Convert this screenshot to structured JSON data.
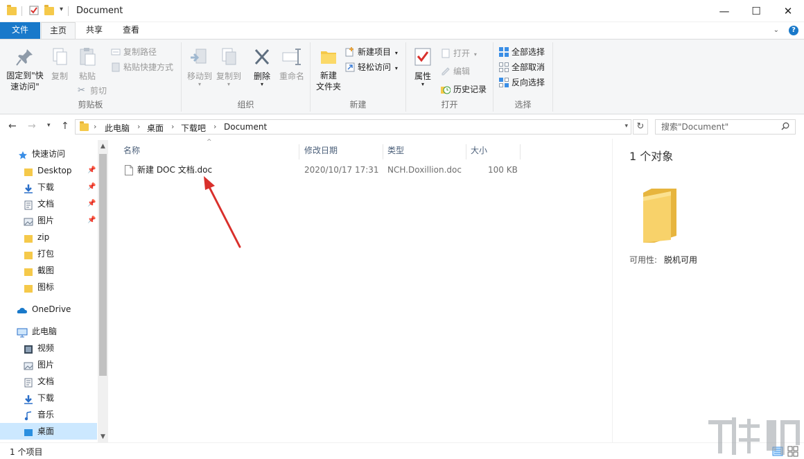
{
  "window": {
    "title": "Document",
    "minimize_glyph": "—",
    "maximize_glyph": "☐",
    "close_glyph": "✕"
  },
  "ribbon_tabs": [
    {
      "label": "文件"
    },
    {
      "label": "主页"
    },
    {
      "label": "共享"
    },
    {
      "label": "查看"
    }
  ],
  "ribbon": {
    "clipboard": {
      "label": "剪贴板",
      "pin_label": "固定到\"快速访问\"",
      "copy_label": "复制",
      "paste_label": "粘贴",
      "copy_path_label": "复制路径",
      "paste_shortcut_label": "粘贴快捷方式",
      "cut_label": "剪切"
    },
    "organize": {
      "label": "组织",
      "move_to_label": "移动到",
      "copy_to_label": "复制到",
      "delete_label": "删除",
      "rename_label": "重命名"
    },
    "new": {
      "label": "新建",
      "new_folder_label": "新建\n文件夹",
      "new_item_label": "新建项目",
      "easy_access_label": "轻松访问"
    },
    "open": {
      "label": "打开",
      "properties_label": "属性",
      "open_label": "打开",
      "edit_label": "编辑",
      "history_label": "历史记录"
    },
    "select": {
      "label": "选择",
      "select_all_label": "全部选择",
      "select_none_label": "全部取消",
      "invert_label": "反向选择"
    }
  },
  "address": {
    "crumbs": [
      "此电脑",
      "桌面",
      "下载吧",
      "Document"
    ],
    "search_placeholder": "搜索\"Document\""
  },
  "nav_pane": {
    "quick_access": "快速访问",
    "items": [
      {
        "label": "Desktop",
        "pinned": true
      },
      {
        "label": "下载",
        "pinned": true
      },
      {
        "label": "文档",
        "pinned": true
      },
      {
        "label": "图片",
        "pinned": true
      },
      {
        "label": "zip",
        "pinned": false
      },
      {
        "label": "打包",
        "pinned": false
      },
      {
        "label": "截图",
        "pinned": false
      },
      {
        "label": "图标",
        "pinned": false
      }
    ],
    "onedrive": "OneDrive",
    "this_pc": "此电脑",
    "pc_items": [
      {
        "label": "视频"
      },
      {
        "label": "图片"
      },
      {
        "label": "文档"
      },
      {
        "label": "下载"
      },
      {
        "label": "音乐"
      },
      {
        "label": "桌面"
      }
    ]
  },
  "file_list": {
    "columns": {
      "name": "名称",
      "modified": "修改日期",
      "type": "类型",
      "size": "大小"
    },
    "rows": [
      {
        "name": "新建 DOC 文档.doc",
        "modified": "2020/10/17 17:31",
        "type": "NCH.Doxillion.doc",
        "size": "100 KB"
      }
    ]
  },
  "preview": {
    "count": "1 个对象",
    "availability_label": "可用性:",
    "availability_value": "脱机可用"
  },
  "status": {
    "count": "1 个项目"
  },
  "colors": {
    "file_tab": "#1979ca",
    "selection": "#cce8ff",
    "folder": "#f5c94a",
    "arrow": "#d9302c"
  }
}
